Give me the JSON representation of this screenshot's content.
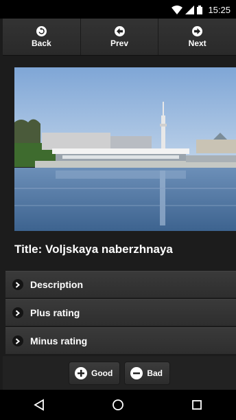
{
  "status_bar": {
    "time": "15:25"
  },
  "toolbar": {
    "back_label": "Back",
    "prev_label": "Prev",
    "next_label": "Next"
  },
  "item": {
    "title": "Title: Voljskaya naberzhnaya"
  },
  "sections": [
    {
      "label": "Description"
    },
    {
      "label": "Plus rating"
    },
    {
      "label": "Minus rating"
    }
  ],
  "vote": {
    "good_label": "Good",
    "bad_label": "Bad"
  },
  "colors": {
    "background": "#1c1c1c",
    "toolbar": "#2a2a2a",
    "row": "#333333",
    "status_bar": "#000000"
  }
}
